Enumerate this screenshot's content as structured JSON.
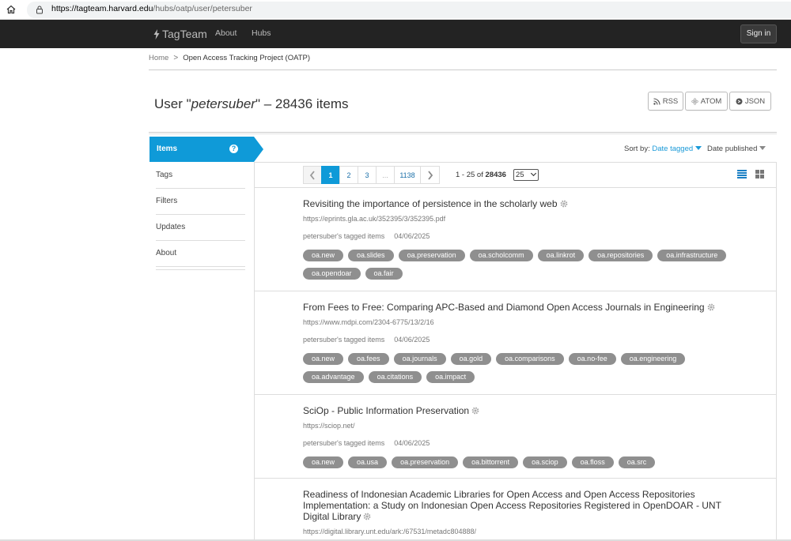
{
  "browser": {
    "url_host": "https://tagteam.harvard.edu",
    "url_path": "/hubs/oatp/user/petersuber"
  },
  "navbar": {
    "brand": "TagTeam",
    "links": [
      "About",
      "Hubs"
    ],
    "signin_label": "Sign in"
  },
  "breadcrumb": {
    "home": "Home",
    "sep": ">",
    "current": "Open Access Tracking Project (OATP)"
  },
  "header": {
    "title_prefix": "User \"",
    "username": "petersuber",
    "title_suffix": "\" – 28436 items",
    "feeds": [
      "RSS",
      "ATOM",
      "JSON"
    ]
  },
  "sidebar": {
    "active": "Items",
    "help": "?",
    "items": [
      "Tags",
      "Filters",
      "Updates",
      "About"
    ]
  },
  "sort": {
    "sort_by_label": "Sort by:",
    "sort_by_value": "Date tagged",
    "secondary": "Date published"
  },
  "pagination": {
    "pages": [
      "1",
      "2",
      "3",
      "...",
      "1138"
    ],
    "range_prefix": "1 - 25 of ",
    "total": "28436",
    "per_page": "25"
  },
  "items": [
    {
      "title": "Revisiting the importance of persistence in the scholarly web",
      "url": "https://eprints.gla.ac.uk/352395/3/352395.pdf",
      "tagged_by": "petersuber's tagged items",
      "date": "04/06/2025",
      "tags": [
        "oa.new",
        "oa.slides",
        "oa.preservation",
        "oa.scholcomm",
        "oa.linkrot",
        "oa.repositories",
        "oa.infrastructure",
        "oa.opendoar",
        "oa.fair"
      ]
    },
    {
      "title": "From Fees to Free: Comparing APC-Based and Diamond Open Access Journals in Engineering",
      "url": "https://www.mdpi.com/2304-6775/13/2/16",
      "tagged_by": "petersuber's tagged items",
      "date": "04/06/2025",
      "tags": [
        "oa.new",
        "oa.fees",
        "oa.journals",
        "oa.gold",
        "oa.comparisons",
        "oa.no-fee",
        "oa.engineering",
        "oa.advantage",
        "oa.citations",
        "oa.impact"
      ]
    },
    {
      "title": "SciOp - Public Information Preservation",
      "url": "https://sciop.net/",
      "tagged_by": "petersuber's tagged items",
      "date": "04/06/2025",
      "tags": [
        "oa.new",
        "oa.usa",
        "oa.preservation",
        "oa.bittorrent",
        "oa.sciop",
        "oa.floss",
        "oa.src"
      ]
    },
    {
      "title": "Readiness of Indonesian Academic Libraries for Open Access and Open Access Repositories Implementation: a Study on Indonesian Open Access Repositories Registered in OpenDOAR - UNT Digital Library",
      "url": "https://digital.library.unt.edu/ark:/67531/metadc804888/",
      "tagged_by": "",
      "date": "",
      "tags": []
    }
  ]
}
